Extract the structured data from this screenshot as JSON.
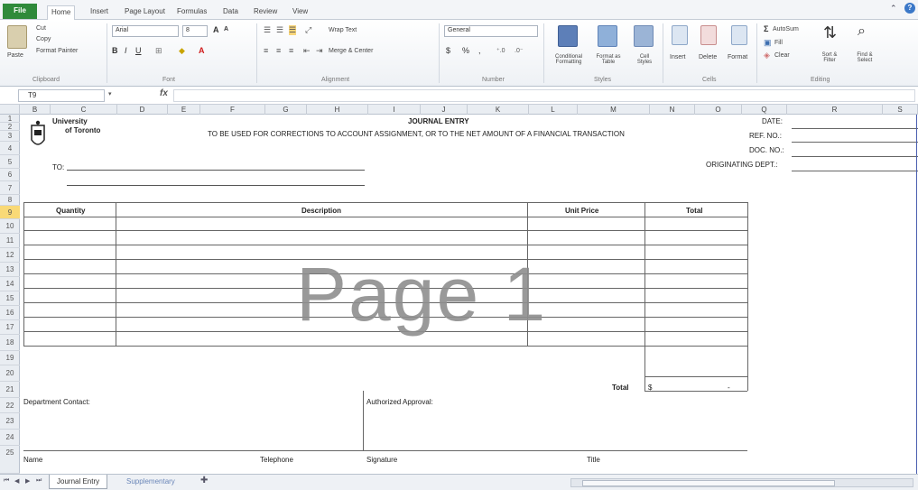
{
  "ribbon_tabs": {
    "file": "File",
    "home": "Home",
    "insert": "Insert",
    "page_layout": "Page Layout",
    "formulas": "Formulas",
    "data": "Data",
    "review": "Review",
    "view": "View"
  },
  "ribbon": {
    "clipboard": {
      "paste": "Paste",
      "cut": "Cut",
      "copy": "Copy",
      "format_painter": "Format Painter",
      "label": "Clipboard"
    },
    "font": {
      "name": "Arial",
      "size": "8",
      "label": "Font"
    },
    "alignment": {
      "wrap_text": "Wrap Text",
      "merge_center": "Merge & Center",
      "label": "Alignment"
    },
    "number": {
      "format": "General",
      "currency": "$",
      "percent": "%",
      "comma": ",",
      "label": "Number"
    },
    "styles": {
      "conditional": "Conditional Formatting",
      "format_table": "Format as Table",
      "cell_styles": "Cell Styles",
      "label": "Styles"
    },
    "cells": {
      "insert": "Insert",
      "delete": "Delete",
      "format": "Format",
      "label": "Cells"
    },
    "editing": {
      "autosum": "AutoSum",
      "fill": "Fill",
      "clear": "Clear",
      "sort_filter": "Sort & Filter",
      "find_select": "Find & Select",
      "label": "Editing"
    }
  },
  "formula_bar": {
    "name_box": "T9",
    "fx": "fx",
    "content": ""
  },
  "columns": [
    "B",
    "C",
    "D",
    "E",
    "F",
    "G",
    "H",
    "I",
    "J",
    "K",
    "L",
    "M",
    "N",
    "O",
    "Q",
    "R",
    "S"
  ],
  "rows": [
    "1",
    "2",
    "3",
    "4",
    "5",
    "6",
    "7",
    "8",
    "9",
    "10",
    "11",
    "12",
    "13",
    "14",
    "15",
    "16",
    "17",
    "18",
    "19",
    "20",
    "21",
    "22",
    "23",
    "24",
    "25"
  ],
  "form": {
    "university_line1": "University",
    "university_line2": "of Toronto",
    "title": "JOURNAL ENTRY",
    "subtitle": "TO BE USED FOR CORRECTIONS TO ACCOUNT ASSIGNMENT, OR TO THE NET AMOUNT OF A FINANCIAL TRANSACTION",
    "to_label": "TO:",
    "date_label": "DATE:",
    "ref_label": "REF. NO.:",
    "doc_label": "DOC. NO.:",
    "dept_label": "ORIGINATING DEPT.:",
    "headers": {
      "quantity": "Quantity",
      "description": "Description",
      "unit_price": "Unit Price",
      "total": "Total"
    },
    "total_label": "Total",
    "total_currency": "$",
    "total_value": "-",
    "dept_contact": "Department Contact:",
    "authorized": "Authorized Approval:",
    "name": "Name",
    "telephone": "Telephone",
    "signature": "Signature",
    "title_label": "Title"
  },
  "watermark": "Page 1",
  "sheet_tabs": {
    "active": "Journal Entry",
    "inactive": "Supplementary"
  },
  "selected_row": "9"
}
